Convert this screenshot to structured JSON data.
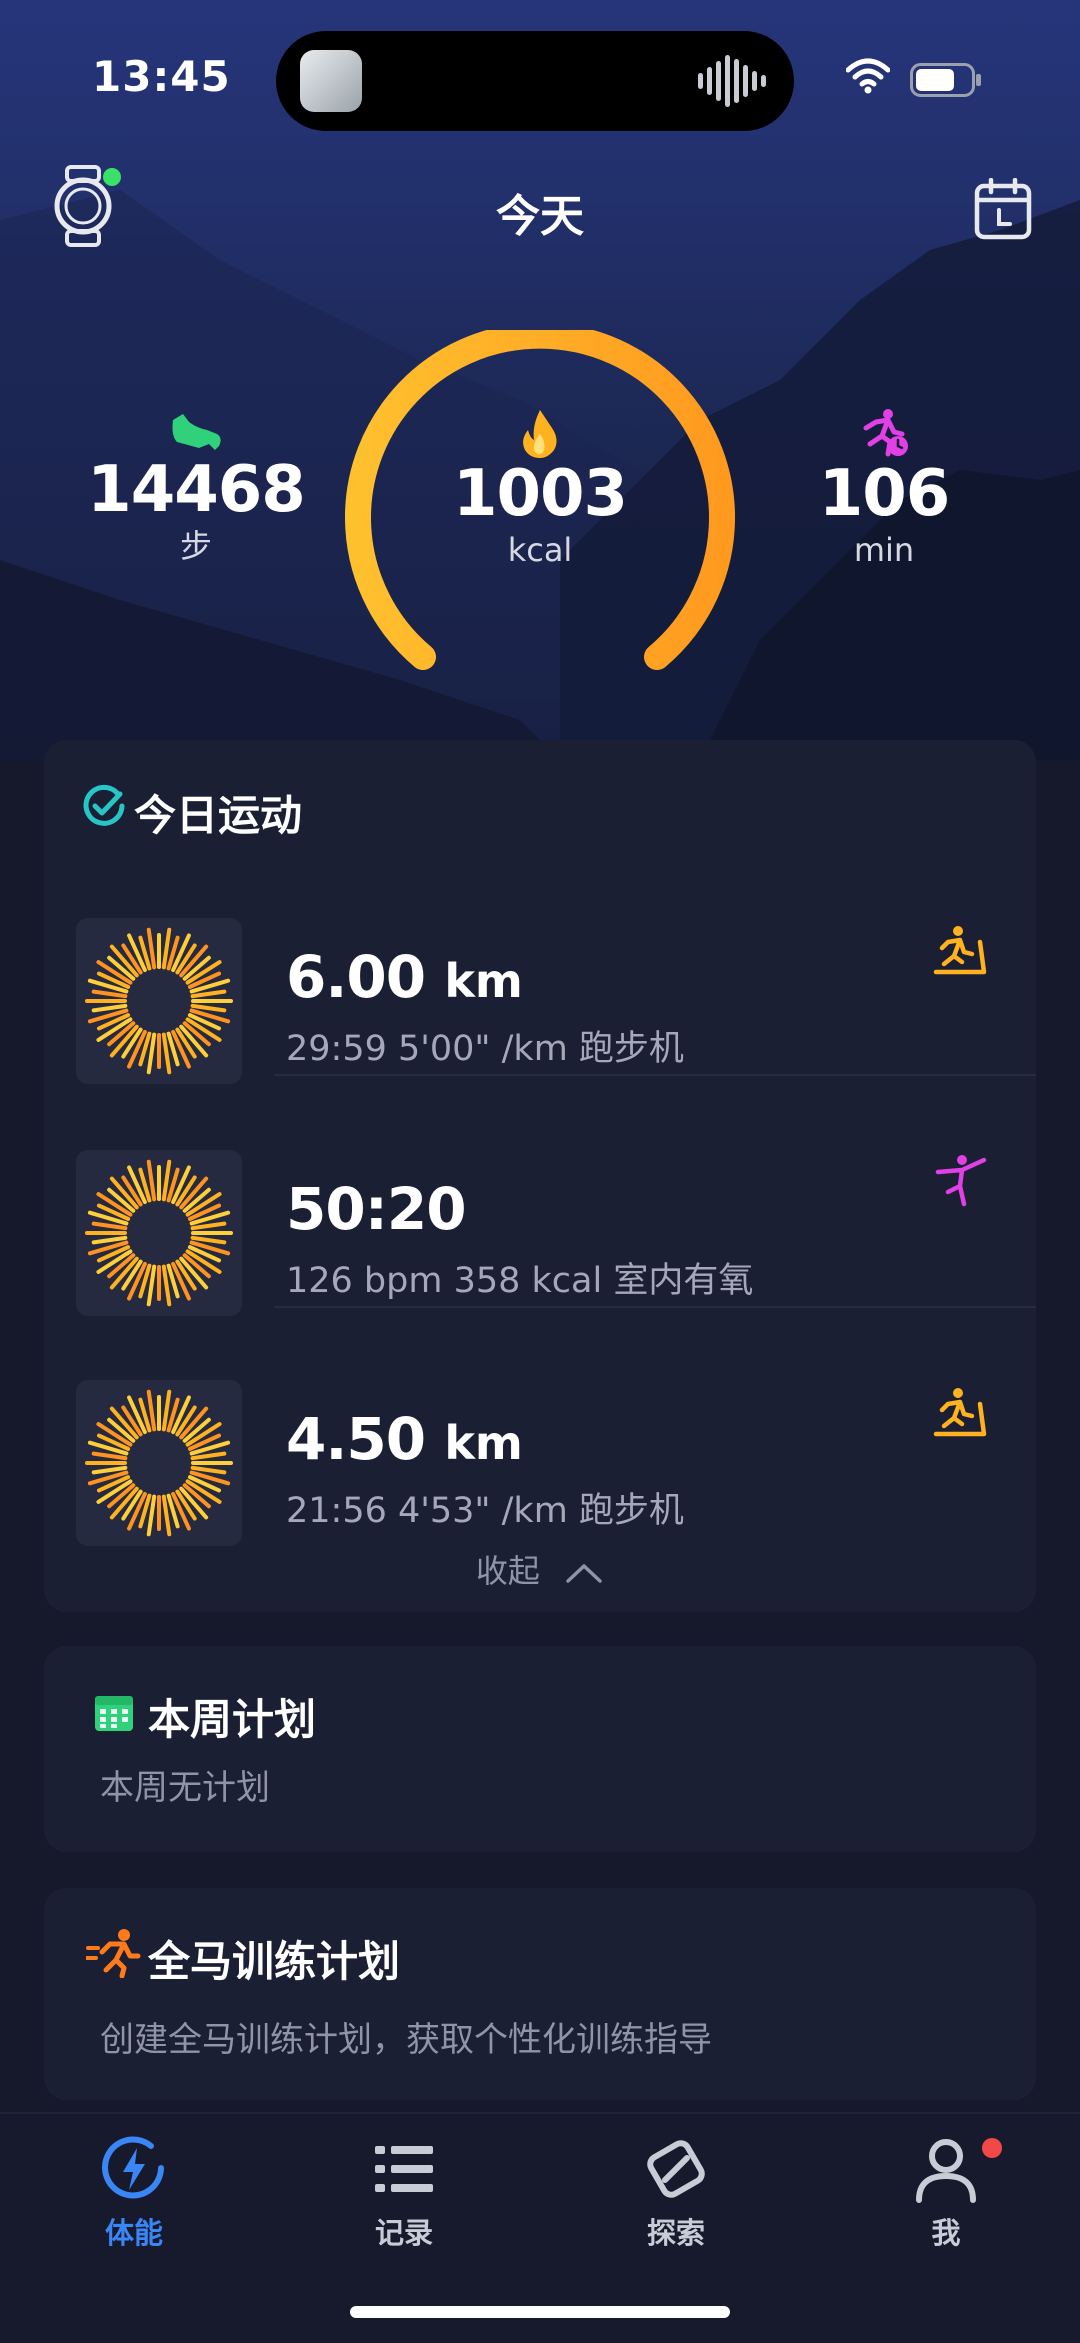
{
  "status_bar": {
    "time": "13:45"
  },
  "header": {
    "title": "今天"
  },
  "summary": {
    "steps": {
      "value": "14468",
      "unit": "步"
    },
    "calories": {
      "value": "1003",
      "unit": "kcal"
    },
    "active_minutes": {
      "value": "106",
      "unit": "min"
    },
    "colors": {
      "gauge_start": "#ffc02e",
      "gauge_end": "#ff9a1f",
      "steps_icon": "#2fd27a",
      "active_icon": "#e040e6"
    }
  },
  "today_activity": {
    "title": "今日运动",
    "items": [
      {
        "main": "6.00",
        "unit": "km",
        "detail": "29:59  5'00\" /km 跑步机",
        "type_icon": "treadmill-icon"
      },
      {
        "main": "50:20",
        "unit": "",
        "detail": "126 bpm  358 kcal 室内有氧",
        "type_icon": "yoga-pose-icon"
      },
      {
        "main": "4.50",
        "unit": "km",
        "detail": "21:56  4'53\" /km 跑步机",
        "type_icon": "treadmill-icon"
      }
    ],
    "collapse_label": "收起"
  },
  "weekly_plan": {
    "title": "本周计划",
    "subtitle": "本周无计划"
  },
  "marathon_plan": {
    "title": "全马训练计划",
    "subtitle": "创建全马训练计划，获取个性化训练指导"
  },
  "tabbar": {
    "tabs": [
      {
        "label": "体能",
        "icon": "lightning-icon",
        "active": true
      },
      {
        "label": "记录",
        "icon": "list-icon",
        "active": false
      },
      {
        "label": "探索",
        "icon": "compass-icon",
        "active": false
      },
      {
        "label": "我",
        "icon": "person-icon",
        "active": false
      }
    ],
    "active_color": "#3b86f7"
  }
}
